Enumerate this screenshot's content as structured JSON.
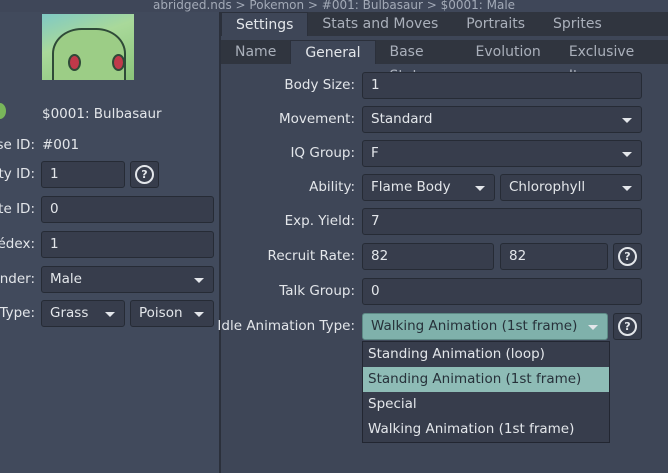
{
  "breadcrumb": "abridged.nds > Pokemon > #001: Bulbasaur > $0001: Male",
  "left": {
    "entry_name": "$0001: Bulbasaur",
    "rows": [
      {
        "label": "Base ID:",
        "value": "#001"
      },
      {
        "label": "Entity ID:",
        "value": "1"
      },
      {
        "label": "Sprite ID:",
        "value": "0"
      },
      {
        "label": "Pokédex:",
        "value": "1"
      },
      {
        "label": "Gender:",
        "value": "Male"
      },
      {
        "label": "Type:",
        "value": "Grass",
        "value2": "Poison"
      }
    ]
  },
  "tabs": [
    "Settings",
    "Stats and Moves",
    "Portraits",
    "Sprites"
  ],
  "subtabs": [
    "Name",
    "General",
    "Base Stats",
    "Evolution",
    "Exclusive Items"
  ],
  "form": {
    "body_size": {
      "label": "Body Size:",
      "value": "1"
    },
    "movement": {
      "label": "Movement:",
      "value": "Standard"
    },
    "iq_group": {
      "label": "IQ Group:",
      "value": "F"
    },
    "ability": {
      "label": "Ability:",
      "value": "Flame Body",
      "value2": "Chlorophyll"
    },
    "exp_yield": {
      "label": "Exp. Yield:",
      "value": "7"
    },
    "recruit_rate": {
      "label": "Recruit Rate:",
      "value": "82",
      "value2": "82"
    },
    "talk_group": {
      "label": "Talk Group:",
      "value": "0"
    },
    "idle_anim": {
      "label": "Idle Animation Type:",
      "value": "Walking Animation (1st frame)",
      "options": [
        "Standing Animation (loop)",
        "Standing Animation (1st frame)",
        "Special",
        "Walking Animation (1st frame)"
      ],
      "highlighted": "Standing Animation (1st frame)"
    }
  },
  "help_glyph": "?",
  "colors": {
    "accent": "#8ebcb6",
    "background": "#3f4759"
  }
}
